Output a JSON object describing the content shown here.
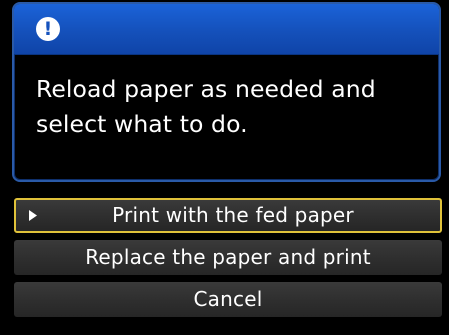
{
  "dialog": {
    "icon": "exclamation-icon",
    "icon_glyph": "!",
    "message": "Reload paper as needed and\nselect what to do."
  },
  "options": [
    {
      "label": "Print with the fed paper",
      "selected": true
    },
    {
      "label": "Replace the paper and print",
      "selected": false
    },
    {
      "label": "Cancel",
      "selected": false
    }
  ],
  "colors": {
    "header_blue": "#1552bd",
    "panel_border": "#2a5aa8",
    "selection_outline": "#e0c23a",
    "button_gray": "#2f2f2f"
  }
}
